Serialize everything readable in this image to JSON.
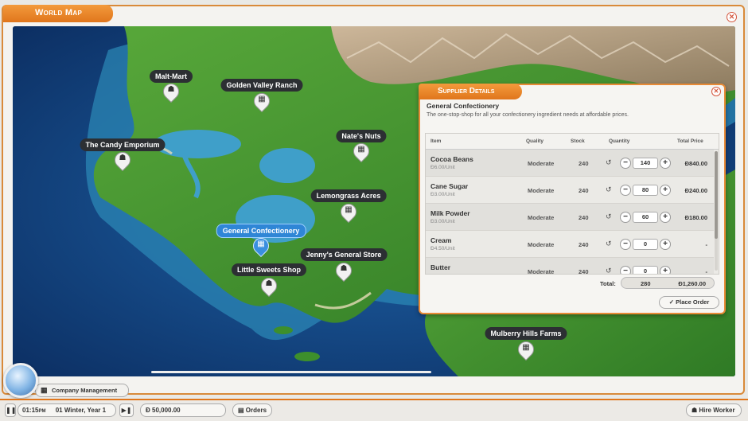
{
  "window": {
    "title": "World Map",
    "close_icon": "close-icon"
  },
  "map": {
    "locations": [
      {
        "id": "malt-mart",
        "label": "Malt-Mart",
        "icon": "person-icon",
        "glyph": "☗"
      },
      {
        "id": "golden-valley",
        "label": "Golden Valley Ranch",
        "icon": "factory-icon",
        "glyph": "▦"
      },
      {
        "id": "nates-nuts",
        "label": "Nate's Nuts",
        "icon": "factory-icon",
        "glyph": "▦"
      },
      {
        "id": "candy-emporium",
        "label": "The Candy Emporium",
        "icon": "person-icon",
        "glyph": "☗"
      },
      {
        "id": "lemongrass",
        "label": "Lemongrass Acres",
        "icon": "factory-icon",
        "glyph": "▦"
      },
      {
        "id": "general-confectionery",
        "label": "General Confectionery",
        "icon": "factory-icon",
        "glyph": "▦",
        "active": true
      },
      {
        "id": "jennys",
        "label": "Jenny's General Store",
        "icon": "person-icon",
        "glyph": "☗"
      },
      {
        "id": "little-sweets",
        "label": "Little Sweets Shop",
        "icon": "person-icon",
        "glyph": "☗"
      },
      {
        "id": "mulberry",
        "label": "Mulberry Hills Farms",
        "icon": "factory-icon",
        "glyph": "▦"
      }
    ]
  },
  "supplier": {
    "title": "Supplier Details",
    "name": "General Confectionery",
    "description": "The one-stop-shop for all your confectionery ingredient needs at affordable prices.",
    "columns": {
      "item": "Item",
      "quality": "Quality",
      "stock": "Stock",
      "quantity": "Quantity",
      "total": "Total Price"
    },
    "rows": [
      {
        "item": "Cocoa Beans",
        "price": "Đ6.00/Unit",
        "quality": "Moderate",
        "stock": "240",
        "quantity": "140",
        "total": "Đ840.00"
      },
      {
        "item": "Cane Sugar",
        "price": "Đ3.00/Unit",
        "quality": "Moderate",
        "stock": "240",
        "quantity": "80",
        "total": "Đ240.00"
      },
      {
        "item": "Milk Powder",
        "price": "Đ3.00/Unit",
        "quality": "Moderate",
        "stock": "240",
        "quantity": "60",
        "total": "Đ180.00"
      },
      {
        "item": "Cream",
        "price": "Đ4.50/Unit",
        "quality": "Moderate",
        "stock": "240",
        "quantity": "0",
        "total": "-"
      },
      {
        "item": "Butter",
        "price": "",
        "quality": "Moderate",
        "stock": "240",
        "quantity": "0",
        "total": "-"
      }
    ],
    "total_label": "Total:",
    "total_quantity": "280",
    "total_price": "Đ1,260.00",
    "place_order": "Place Order"
  },
  "hud": {
    "company_management": "Company Management",
    "time": "01:15",
    "time_unit": "PM",
    "date": "01 Winter, Year 1",
    "money": "Đ 50,000.00",
    "orders": "Orders",
    "hire_worker": "Hire Worker"
  },
  "colors": {
    "accent": "#e0761c",
    "active_pin": "#3a8fe0"
  }
}
